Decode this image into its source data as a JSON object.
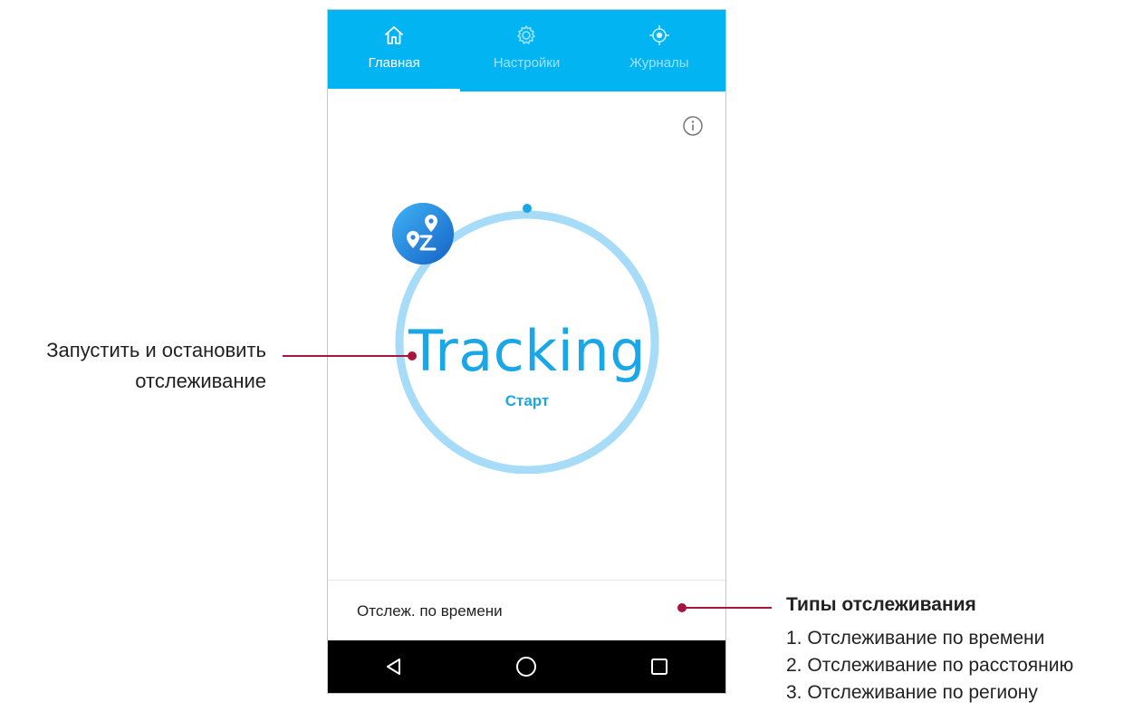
{
  "tabs": [
    {
      "label": "Главная",
      "icon": "home-icon",
      "active": true
    },
    {
      "label": "Настройки",
      "icon": "gear-icon",
      "active": false
    },
    {
      "label": "Журналы",
      "icon": "location-target-icon",
      "active": false
    }
  ],
  "main": {
    "title": "Tracking",
    "start_label": "Старт",
    "logo_icon": "route-pin-icon"
  },
  "tracking_mode": {
    "label": "Отслеж. по времени"
  },
  "navbar": {
    "icons": [
      "back-triangle-icon",
      "home-circle-icon",
      "recent-square-icon"
    ]
  },
  "annotations": {
    "start_stop": {
      "line1": "Запустить и остановить",
      "line2": "отслеживание"
    },
    "types": {
      "header": "Типы отслеживания",
      "items": [
        "1. Отслеживание по времени",
        "2. Отслеживание по расстоянию",
        "3. Отслеживание по региону"
      ]
    }
  },
  "colors": {
    "topbar": "#03b4f3",
    "accent": "#1aa7e8",
    "ring": "#a6dcf8",
    "callout": "#a7143c"
  }
}
